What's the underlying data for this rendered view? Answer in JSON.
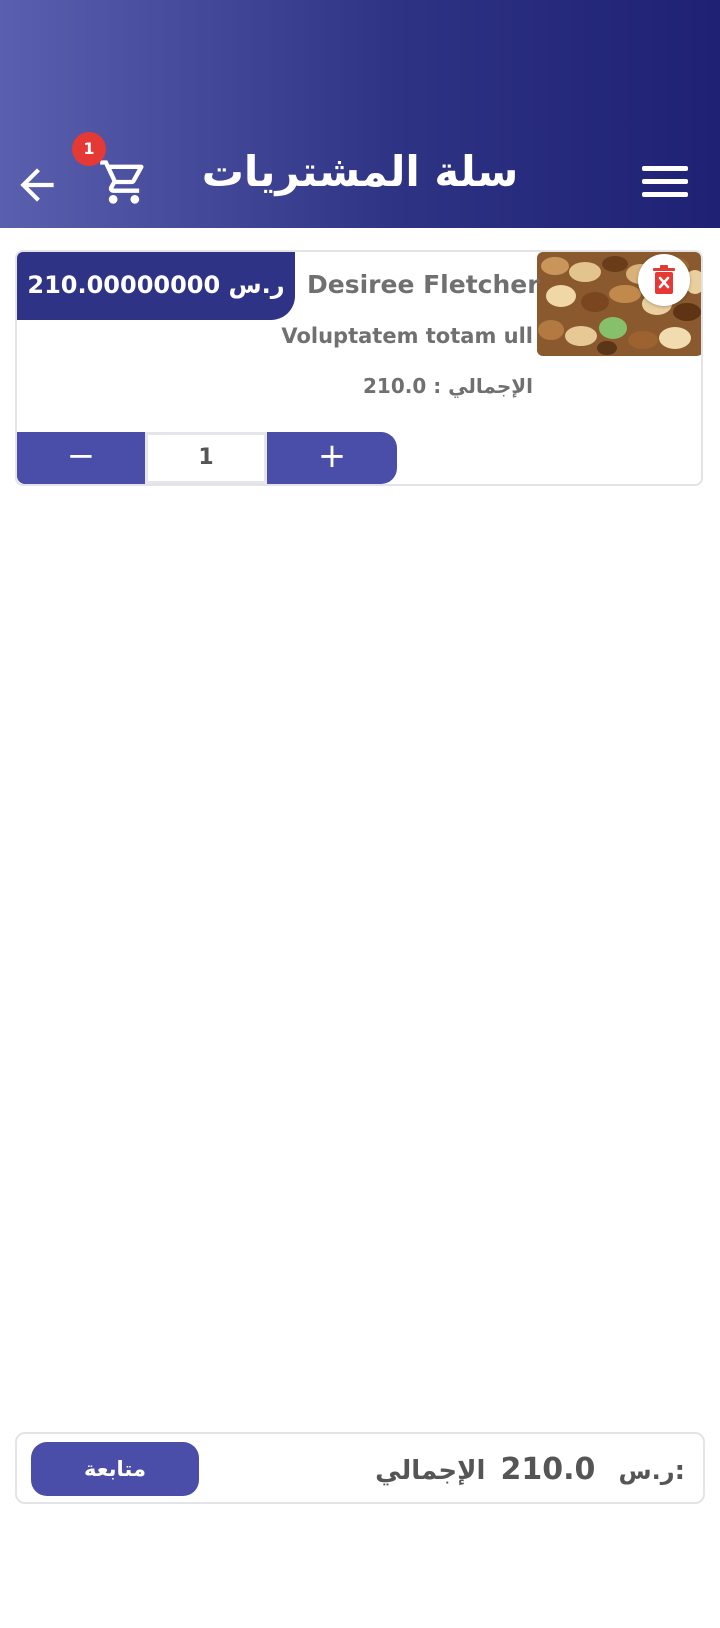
{
  "header": {
    "title": "سلة المشتريات",
    "cart_count": "1",
    "colors": {
      "gradient_start": "#5a5fae",
      "gradient_end": "#1e2174"
    }
  },
  "cart_items": [
    {
      "price_tag": "210.00000000 ر.س",
      "name": "Desiree Fletcher",
      "description": "Voluptatem totam ull",
      "total_line": "الإجمالي : 210.0",
      "quantity": "1",
      "image": "mixed-nuts-photo"
    }
  ],
  "stepper": {
    "minus_label": "−",
    "plus_label": "+"
  },
  "footer": {
    "total_label": "الإجمالي:",
    "total_amount": "210.0",
    "currency": "ر.س",
    "continue_label": "متابعة"
  },
  "icons": [
    "menu-icon",
    "cart-icon",
    "back-arrow-icon",
    "delete-icon"
  ]
}
